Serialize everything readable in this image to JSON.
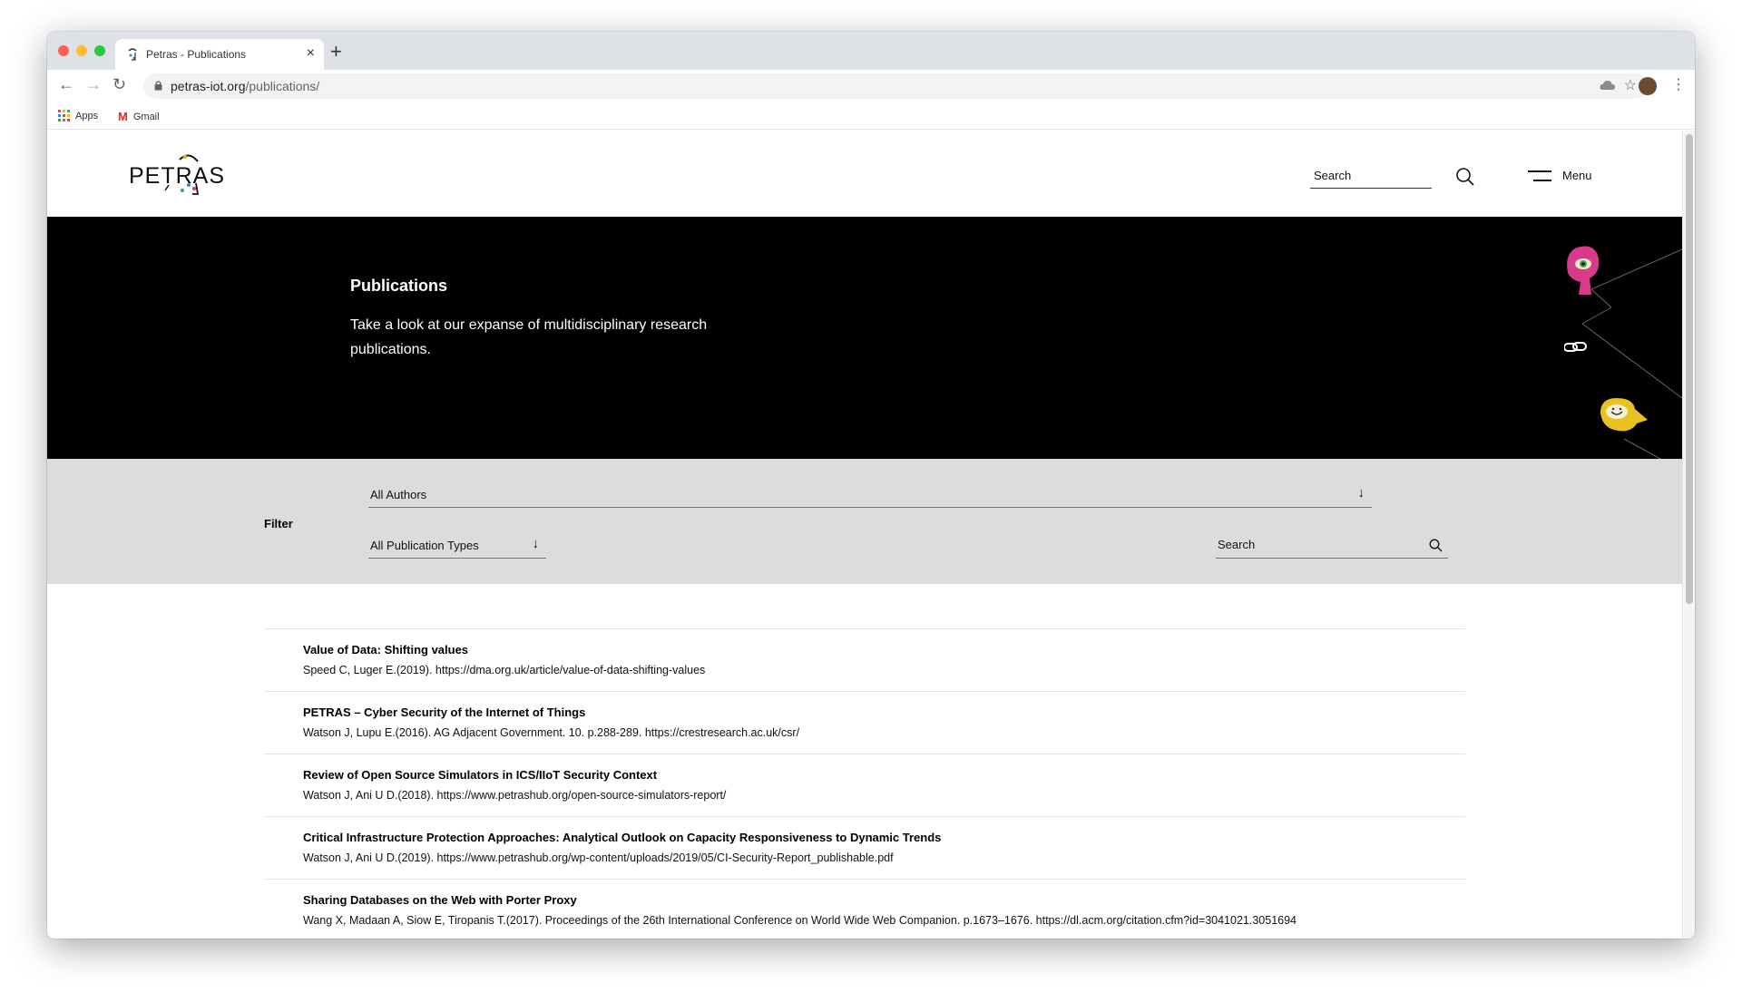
{
  "browser": {
    "tab_title": "Petras - Publications",
    "tab_close": "×",
    "new_tab": "+",
    "url_domain": "petras-iot.org",
    "url_path": "/publications/",
    "bookmarks": [
      {
        "label": "Apps"
      },
      {
        "label": "Gmail"
      }
    ],
    "colors": {
      "tabstrip": "#dee1e6",
      "omnibox": "#f1f3f4"
    }
  },
  "header": {
    "logo_text": "PETRAS",
    "search_placeholder": "Search",
    "menu_label": "Menu"
  },
  "hero": {
    "title": "Publications",
    "text": "Take a look at our expanse of multidisciplinary research publications."
  },
  "filter": {
    "label": "Filter",
    "authors_selected": "All Authors",
    "types_selected": "All Publication Types",
    "search_placeholder": "Search",
    "arrow": "↓"
  },
  "publications": [
    {
      "title": "Value of Data: Shifting values",
      "meta": "Speed C, Luger E.(2019). https://dma.org.uk/article/value-of-data-shifting-values"
    },
    {
      "title": "PETRAS – Cyber Security of the Internet of Things",
      "meta": "Watson J, Lupu E.(2016). AG Adjacent Government. 10. p.288-289. https://crestresearch.ac.uk/csr/"
    },
    {
      "title": "Review of Open Source Simulators in ICS/IIoT Security Context",
      "meta": "Watson J, Ani U D.(2018). https://www.petrashub.org/open-source-simulators-report/"
    },
    {
      "title": "Critical Infrastructure Protection Approaches: Analytical Outlook on Capacity Responsiveness to Dynamic Trends",
      "meta": "Watson J, Ani U D.(2019). https://www.petrashub.org/wp-content/uploads/2019/05/CI-Security-Report_publishable.pdf"
    },
    {
      "title": "Sharing Databases on the Web with Porter Proxy",
      "meta": "Wang X, Madaan A, Siow E, Tiropanis T.(2017). Proceedings of the 26th International Conference on World Wide Web Companion. p.1673–1676. https://dl.acm.org/citation.cfm?id=3041021.3051694"
    }
  ]
}
